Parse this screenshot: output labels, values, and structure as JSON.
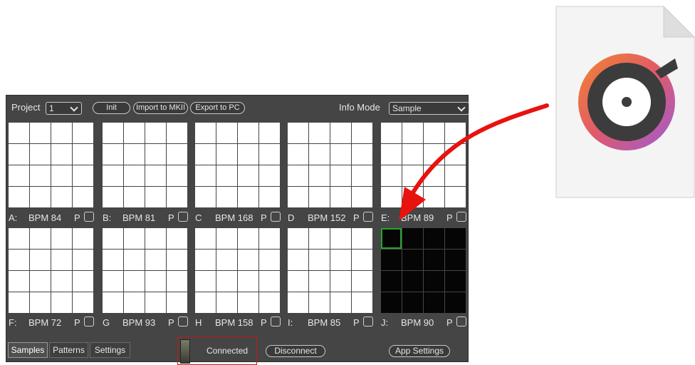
{
  "topbar": {
    "project_label": "Project",
    "project_value": "1",
    "init_label": "Init",
    "import_label": "Import to MKII",
    "export_label": "Export to PC",
    "info_mode_label": "Info Mode",
    "info_mode_value": "Sample"
  },
  "banks": [
    {
      "letter": "A:",
      "bpm": "BPM 84",
      "p": "P"
    },
    {
      "letter": "B:",
      "bpm": "BPM 81",
      "p": "P"
    },
    {
      "letter": "C",
      "bpm": "BPM 168",
      "p": "P"
    },
    {
      "letter": "D",
      "bpm": "BPM 152",
      "p": "P"
    },
    {
      "letter": "E:",
      "bpm": "BPM 89",
      "p": "P"
    },
    {
      "letter": "F:",
      "bpm": "BPM 72",
      "p": "P"
    },
    {
      "letter": "G",
      "bpm": "BPM 93",
      "p": "P"
    },
    {
      "letter": "H",
      "bpm": "BPM 158",
      "p": "P"
    },
    {
      "letter": "I:",
      "bpm": "BPM 85",
      "p": "P"
    },
    {
      "letter": "J:",
      "bpm": "BPM 90",
      "p": "P"
    }
  ],
  "bottom": {
    "tabs": [
      "Samples",
      "Patterns",
      "Settings"
    ],
    "active_tab": "Samples",
    "status": "Connected",
    "disconnect_label": "Disconnect",
    "app_settings_label": "App Settings"
  },
  "file_icon": {
    "name": "audio-file-icon",
    "accent": "#f0713a",
    "accent2": "#9b5cd6"
  },
  "colors": {
    "arrow": "#e8120e",
    "selected_pad": "#22a52c",
    "panel": "#454545"
  }
}
